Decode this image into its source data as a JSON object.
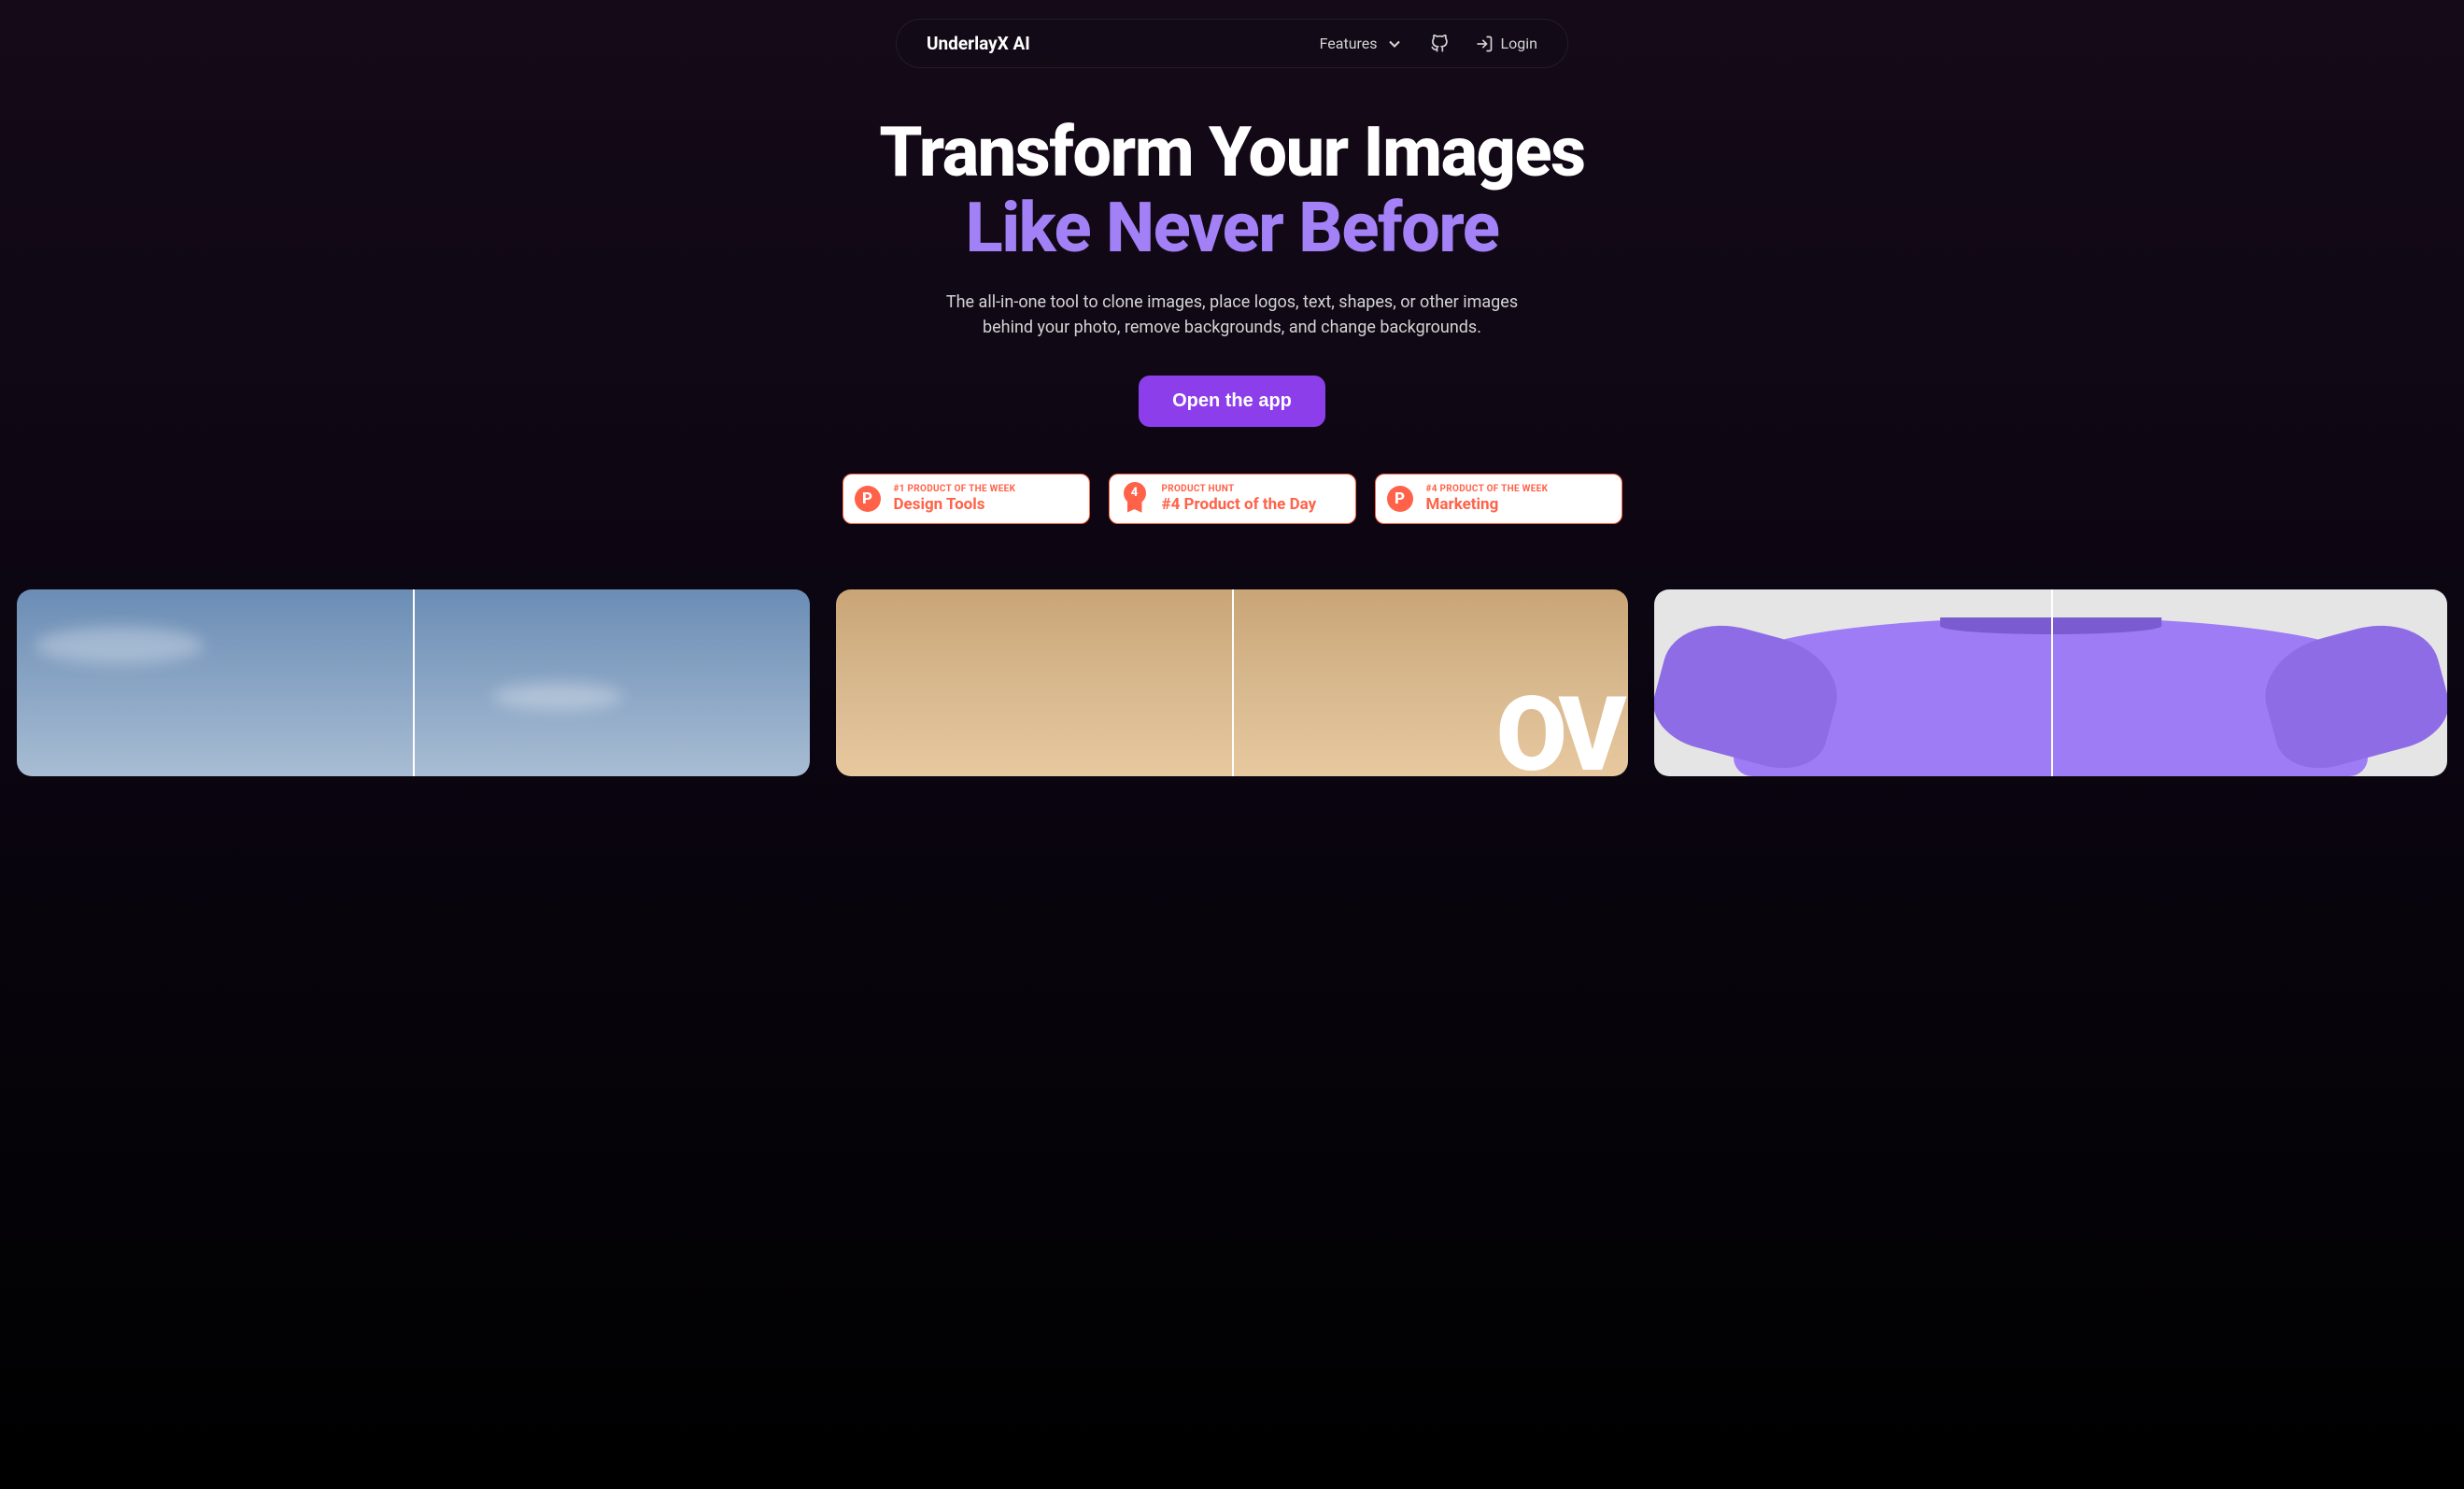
{
  "nav": {
    "brand": "UnderlayX AI",
    "features_label": "Features",
    "login_label": "Login"
  },
  "hero": {
    "title_line1": "Transform Your Images",
    "title_line2": "Like Never Before",
    "subtitle": "The all-in-one tool to clone images, place logos, text, shapes, or other images behind your photo, remove backgrounds, and change backgrounds.",
    "cta_label": "Open the app"
  },
  "badges": [
    {
      "icon": "P",
      "label": "#1 PRODUCT OF THE WEEK",
      "title": "Design Tools"
    },
    {
      "icon": "4",
      "label": "PRODUCT HUNT",
      "title": "#4 Product of the Day"
    },
    {
      "icon": "P",
      "label": "#4 PRODUCT OF THE WEEK",
      "title": "Marketing"
    }
  ]
}
